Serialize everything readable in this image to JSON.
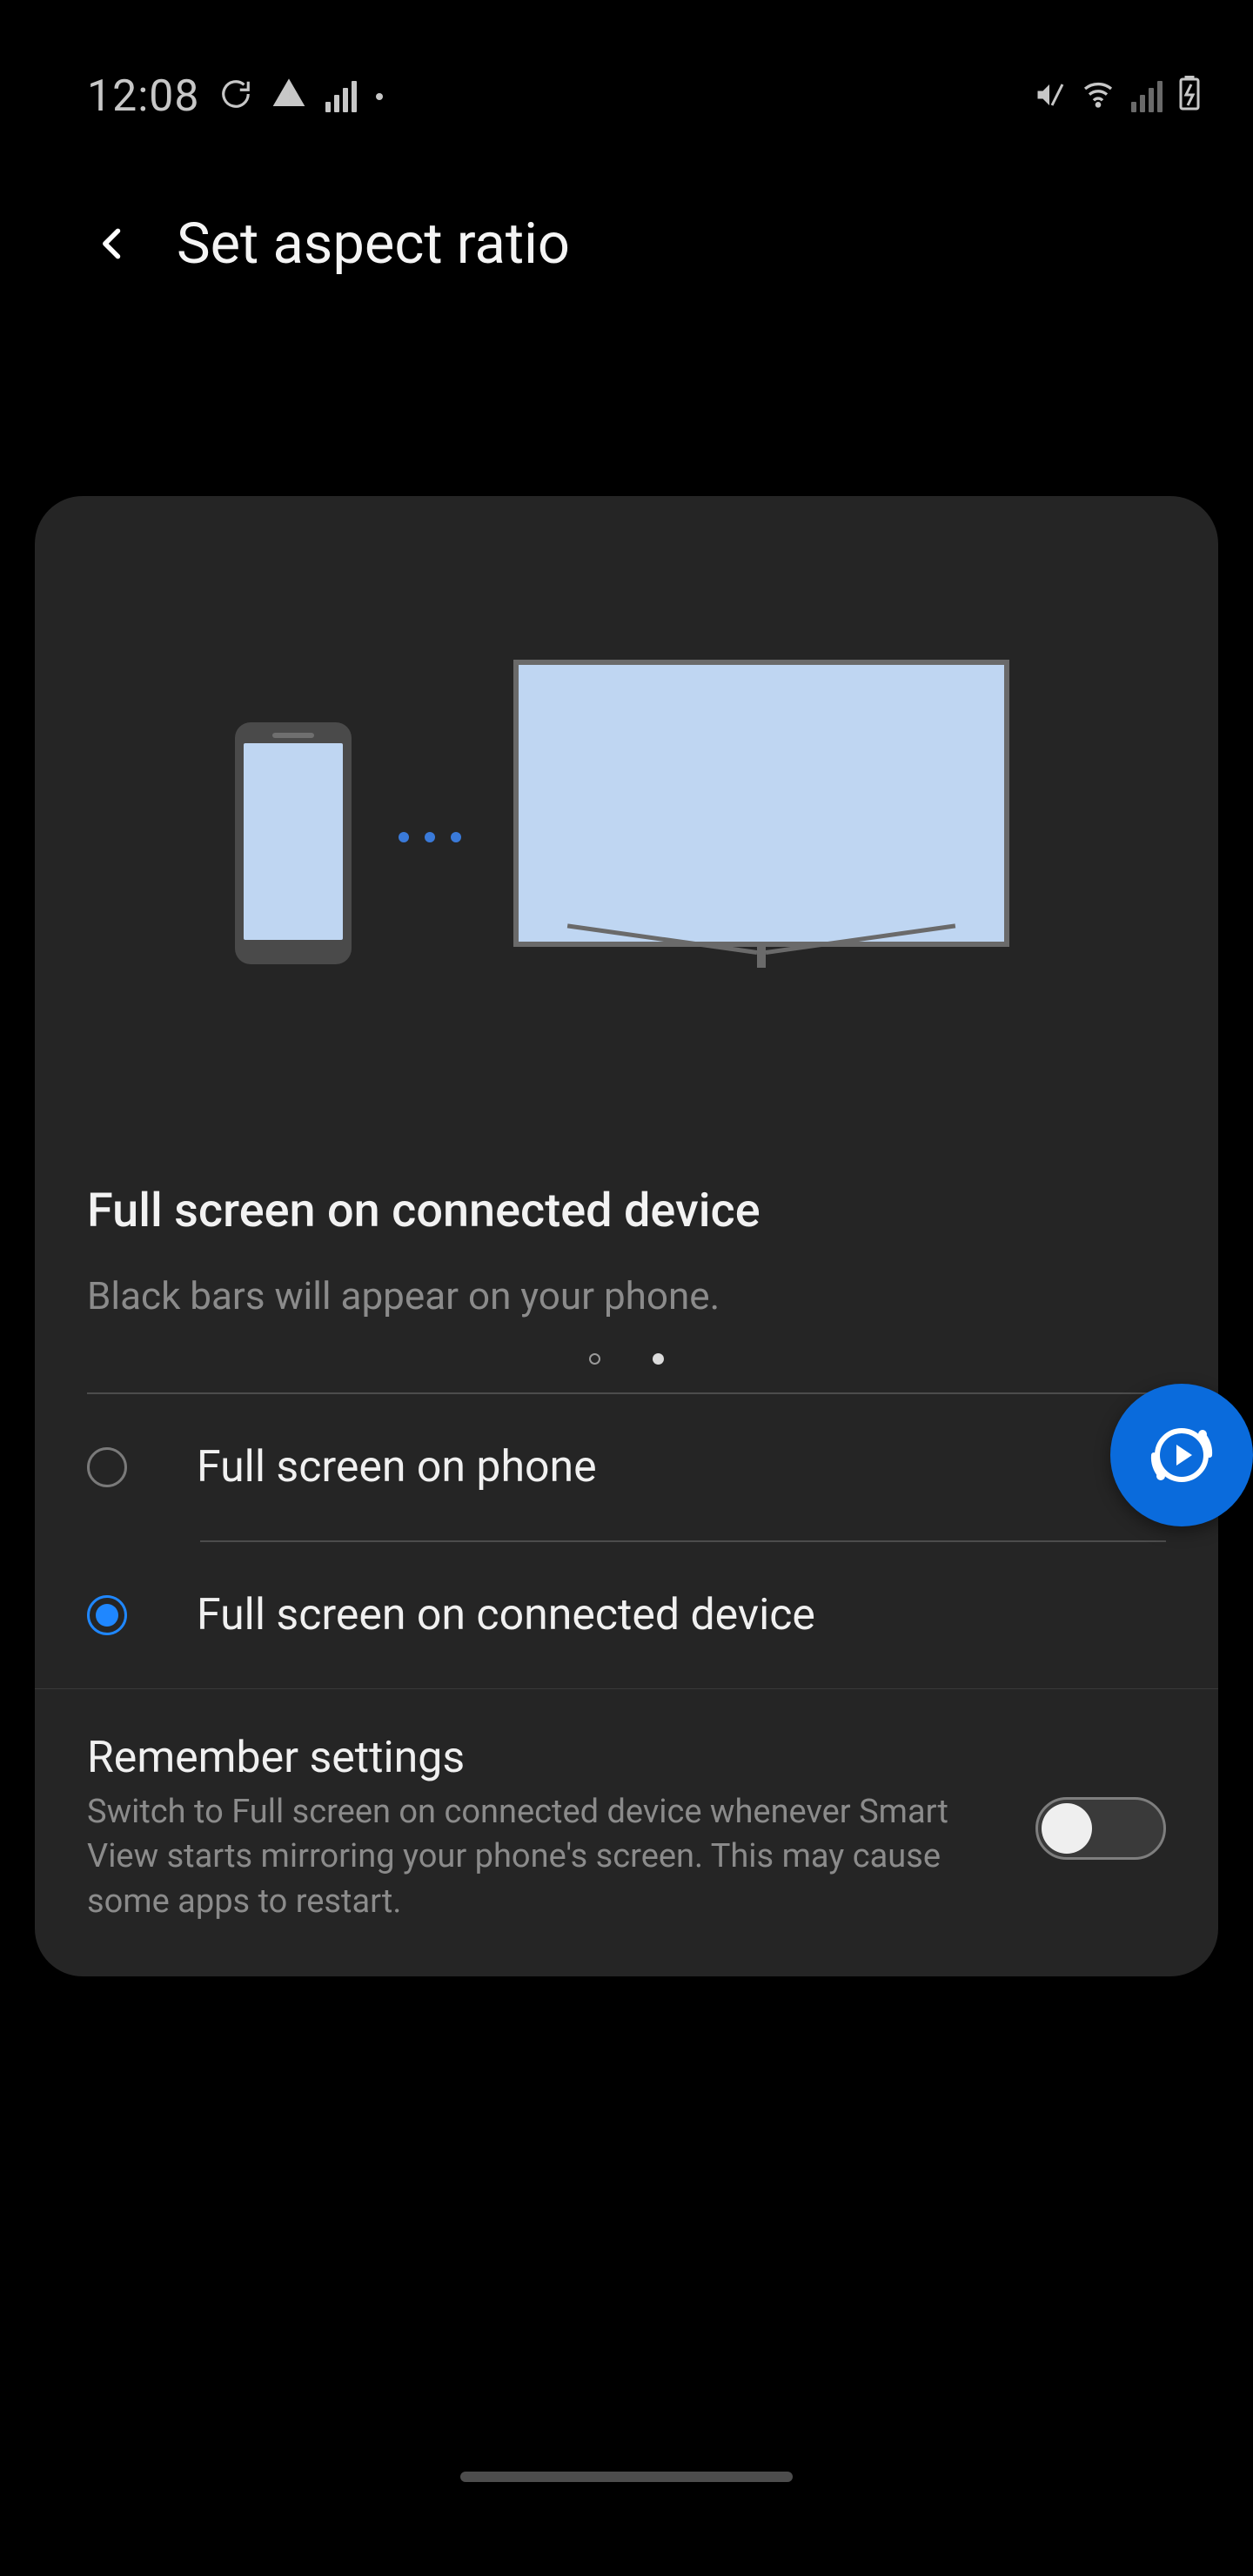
{
  "status": {
    "time": "12:08"
  },
  "header": {
    "title": "Set aspect ratio"
  },
  "preview": {
    "headline": "Full screen on connected device",
    "subline": "Black bars will appear on your phone."
  },
  "options": [
    {
      "label": "Full screen on phone",
      "selected": false
    },
    {
      "label": "Full screen on connected device",
      "selected": true
    }
  ],
  "remember": {
    "title": "Remember settings",
    "description": "Switch to Full screen on connected device whenever Smart View starts mirroring your phone's screen. This may cause some apps to restart.",
    "enabled": false
  },
  "page_indicator": {
    "count": 2,
    "active_index": 1
  }
}
